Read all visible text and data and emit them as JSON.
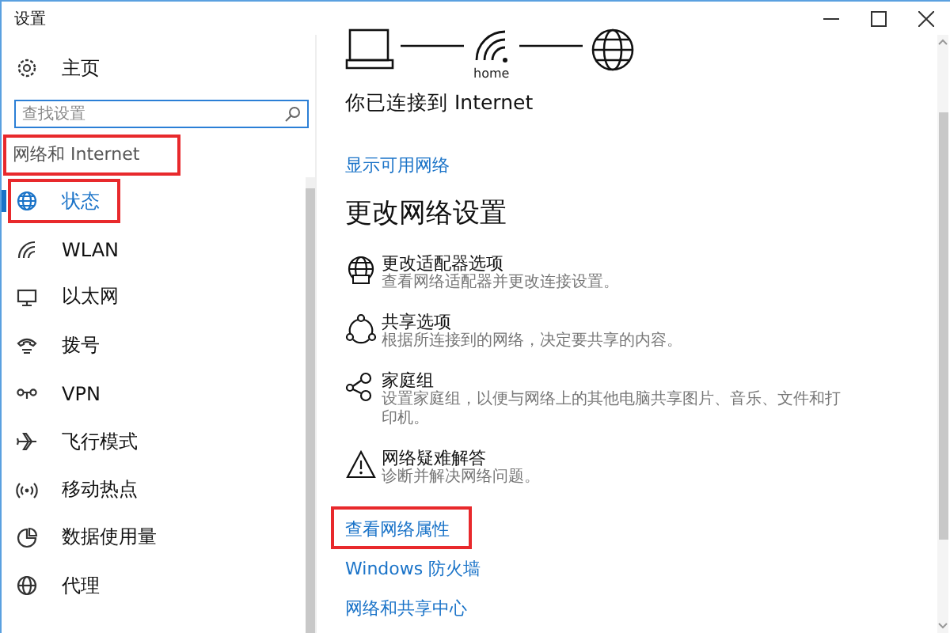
{
  "window": {
    "title": "设置"
  },
  "sidebar": {
    "home": {
      "label": "主页"
    },
    "search": {
      "placeholder": "查找设置"
    },
    "section": {
      "label": "网络和 Internet",
      "highlighted": true
    },
    "items": [
      {
        "label": "状态",
        "selected": true,
        "highlighted": true
      },
      {
        "label": "WLAN",
        "selected": false,
        "highlighted": false
      },
      {
        "label": "以太网",
        "selected": false,
        "highlighted": false
      },
      {
        "label": "拨号",
        "selected": false,
        "highlighted": false
      },
      {
        "label": "VPN",
        "selected": false,
        "highlighted": false
      },
      {
        "label": "飞行模式",
        "selected": false,
        "highlighted": false
      },
      {
        "label": "移动热点",
        "selected": false,
        "highlighted": false
      },
      {
        "label": "数据使用量",
        "selected": false,
        "highlighted": false
      },
      {
        "label": "代理",
        "selected": false,
        "highlighted": false
      }
    ]
  },
  "main": {
    "network_label": "home",
    "status": "你已连接到 Internet",
    "show_networks_link": "显示可用网络",
    "heading": "更改网络设置",
    "settings": [
      {
        "title": "更改适配器选项",
        "description": "查看网络适配器并更改连接设置。"
      },
      {
        "title": "共享选项",
        "description": "根据所连接到的网络，决定要共享的内容。"
      },
      {
        "title": "家庭组",
        "description": "设置家庭组，以便与网络上的其他电脑共享图片、音乐、文件和打印机。"
      },
      {
        "title": "网络疑难解答",
        "description": "诊断并解决网络问题。"
      }
    ],
    "links": [
      {
        "label": "查看网络属性",
        "highlighted": true
      },
      {
        "label": "Windows 防火墙",
        "highlighted": false
      },
      {
        "label": "网络和共享中心",
        "highlighted": false
      }
    ]
  }
}
